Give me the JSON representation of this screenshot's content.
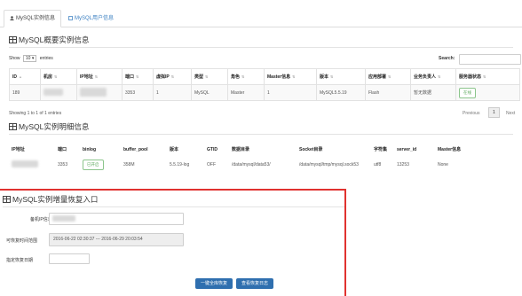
{
  "tabs": [
    {
      "label": "MySQL实例信息"
    },
    {
      "label": "MySQL用户信息"
    }
  ],
  "overview": {
    "title": "MySQL概要实例信息",
    "show_label": "Show",
    "show_value": "10",
    "entries_label": "entries",
    "search_label": "Search:",
    "columns": [
      "ID",
      "机房",
      "IP地址",
      "端口",
      "虚拟IP",
      "类型",
      "角色",
      "Master信息",
      "版本",
      "应用部署",
      "业务负责人",
      "服务器状态"
    ],
    "row": {
      "id": "189",
      "port": "3353",
      "vip": "1",
      "type": "MySQL",
      "role": "Master",
      "master_info": "1",
      "version": "MySQL5.5.19",
      "deploy": "Flash",
      "owner": "暂无数据",
      "status": "在线"
    },
    "showing": "Showing 1 to 1 of 1 entries",
    "pagination": {
      "prev": "Previous",
      "current": "1",
      "next": "Next"
    }
  },
  "detail": {
    "title": "MySQL实例明细信息",
    "columns": [
      "IP地址",
      "端口",
      "binlog",
      "buffer_pool",
      "版本",
      "GTID",
      "数据目录",
      "Socket目录",
      "字符集",
      "server_id",
      "Master信息"
    ],
    "row": {
      "port": "3353",
      "binlog": "已开启",
      "buffer_pool": "358M",
      "version": "5.5.19-log",
      "gtid": "OFF",
      "datadir": "/data/mysql/data53/",
      "socket": "/data/mysql/tmp/mysql.sock53",
      "charset": "utf8",
      "server_id": "13253",
      "master_info": "None"
    }
  },
  "restore": {
    "title": "MySQL实例增量恢复入口",
    "backup_label": "备机IP信息",
    "range_label": "可恢复时间范围",
    "range_value": "2016-06-22 02:30:37 --- 2016-06-29 20:03:54",
    "date_label": "指定恢复日期",
    "restore_button": "一键全库恢复",
    "log_button": "查看恢复日志"
  }
}
